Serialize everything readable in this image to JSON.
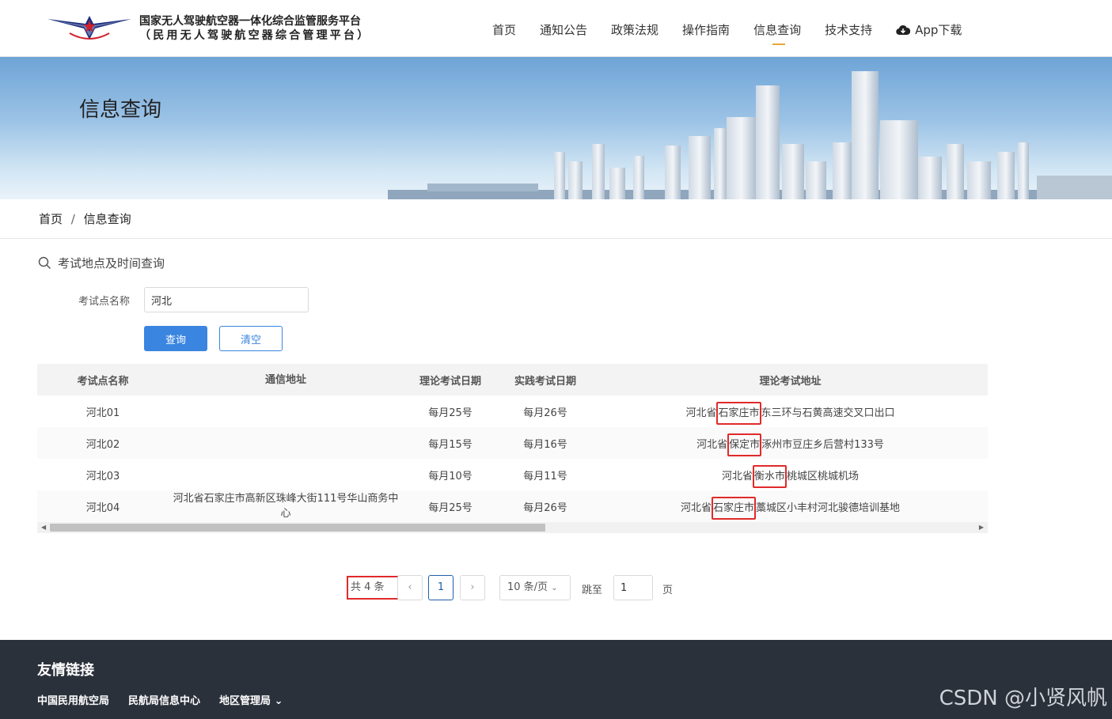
{
  "header": {
    "title_line1": "国家无人驾驶航空器一体化综合监管服务平台",
    "title_line2": "（民用无人驾驶航空器综合管理平台）",
    "nav": [
      {
        "label": "首页"
      },
      {
        "label": "通知公告"
      },
      {
        "label": "政策法规"
      },
      {
        "label": "操作指南"
      },
      {
        "label": "信息查询"
      },
      {
        "label": "技术支持"
      }
    ],
    "app_download": "App下载",
    "active_nav": "信息查询"
  },
  "banner": {
    "title": "信息查询"
  },
  "breadcrumb": {
    "home": "首页",
    "sep": "/",
    "current": "信息查询"
  },
  "search": {
    "section_title": "考试地点及时间查询",
    "label": "考试点名称",
    "value": "河北",
    "query_button": "查询",
    "clear_button": "清空"
  },
  "table": {
    "headers": [
      "考试点名称",
      "通信地址",
      "理论考试日期",
      "实践考试日期",
      "理论考试地址"
    ],
    "rows": [
      {
        "name": "河北01",
        "address": "",
        "theory_date": "每月25号",
        "practice_date": "每月26号",
        "theory_addr_pre": "河北省",
        "theory_addr_hl": "石家庄市",
        "theory_addr_post": "东三环与石黄高速交叉口出口"
      },
      {
        "name": "河北02",
        "address": "",
        "theory_date": "每月15号",
        "practice_date": "每月16号",
        "theory_addr_pre": "河北省",
        "theory_addr_hl": "保定市",
        "theory_addr_post": "涿州市豆庄乡后营村133号"
      },
      {
        "name": "河北03",
        "address": "",
        "theory_date": "每月10号",
        "practice_date": "每月11号",
        "theory_addr_pre": "河北省",
        "theory_addr_hl": "衡水市",
        "theory_addr_post": "桃城区桃城机场"
      },
      {
        "name": "河北04",
        "address": "河北省石家庄市高新区珠峰大街111号华山商务中心",
        "theory_date": "每月25号",
        "practice_date": "每月26号",
        "theory_addr_pre": "河北省",
        "theory_addr_hl": "石家庄市",
        "theory_addr_post": "藁城区小丰村河北骏德培训基地"
      }
    ]
  },
  "pagination": {
    "total": "共 4 条",
    "current_page": "1",
    "page_size": "10 条/页",
    "jump_label": "跳至",
    "jump_value": "1",
    "unit": "页"
  },
  "footer": {
    "title": "友情链接",
    "links": [
      "中国民用航空局",
      "民航局信息中心",
      "地区管理局"
    ]
  },
  "watermark": "CSDN @小贤风帆",
  "colors": {
    "primary": "#3a85e0",
    "highlight": "#e02a2a",
    "footer_bg": "#2b313b",
    "nav_underline": "#e8a43a"
  }
}
